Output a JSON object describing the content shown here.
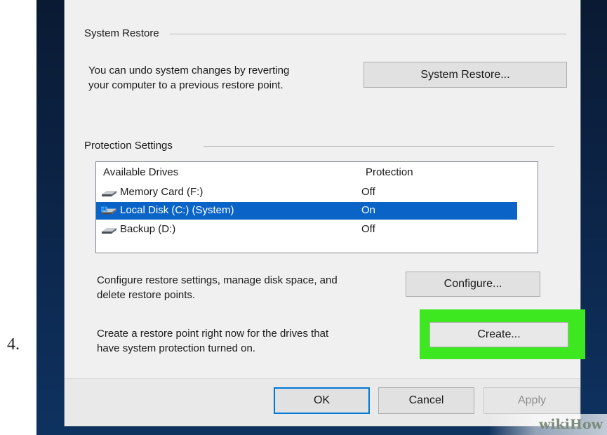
{
  "step": {
    "number": "4."
  },
  "system_restore": {
    "group_title": "System Restore",
    "description_line1": "You can undo system changes by reverting",
    "description_line2": "your computer to a previous restore point.",
    "button_label": "System Restore..."
  },
  "protection": {
    "group_title": "Protection Settings",
    "columns": {
      "drives": "Available Drives",
      "protection": "Protection"
    },
    "drives": [
      {
        "name": "Memory Card (F:)",
        "protection": "Off",
        "icon": "removable-drive-icon",
        "selected": false
      },
      {
        "name": "Local Disk (C:) (System)",
        "protection": "On",
        "icon": "system-drive-icon",
        "selected": true
      },
      {
        "name": "Backup (D:)",
        "protection": "Off",
        "icon": "drive-icon",
        "selected": false
      }
    ]
  },
  "configure": {
    "text_line1": "Configure restore settings, manage disk space, and",
    "text_line2": "delete restore points.",
    "button_label": "Configure..."
  },
  "create": {
    "text_line1": "Create a restore point right now for the drives that",
    "text_line2": "have system protection turned on.",
    "button_label": "Create...",
    "highlight_color": "#3ee820"
  },
  "footer": {
    "ok_label": "OK",
    "cancel_label": "Cancel",
    "apply_label": "Apply"
  },
  "watermark": {
    "text": "wikiHow"
  },
  "colors": {
    "selection": "#0a64c8",
    "desktop": "#0c2447"
  }
}
